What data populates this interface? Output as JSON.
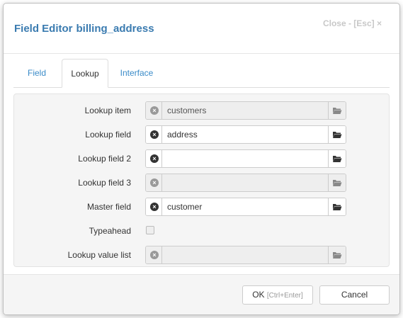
{
  "header": {
    "title_prefix": "Field Editor",
    "title_name": "billing_address",
    "close_label": "Close - [Esc] ×"
  },
  "tabs": [
    {
      "label": "Field",
      "active": false
    },
    {
      "label": "Lookup",
      "active": true
    },
    {
      "label": "Interface",
      "active": false
    }
  ],
  "form": {
    "lookup_item": {
      "label": "Lookup item",
      "value": "customers",
      "disabled": true
    },
    "lookup_field": {
      "label": "Lookup field",
      "value": "address",
      "disabled": false
    },
    "lookup_field_2": {
      "label": "Lookup field 2",
      "value": "",
      "disabled": false
    },
    "lookup_field_3": {
      "label": "Lookup field 3",
      "value": "",
      "disabled": true
    },
    "master_field": {
      "label": "Master field",
      "value": "customer",
      "disabled": false
    },
    "typeahead": {
      "label": "Typeahead",
      "checked": false,
      "disabled": true
    },
    "lookup_value_list": {
      "label": "Lookup value list",
      "value": "",
      "disabled": true
    }
  },
  "footer": {
    "ok_label": "OK",
    "ok_hint": "[Ctrl+Enter]",
    "cancel_label": "Cancel"
  },
  "icons": {
    "clear": "clear-circle-icon",
    "folder": "folder-open-icon"
  }
}
